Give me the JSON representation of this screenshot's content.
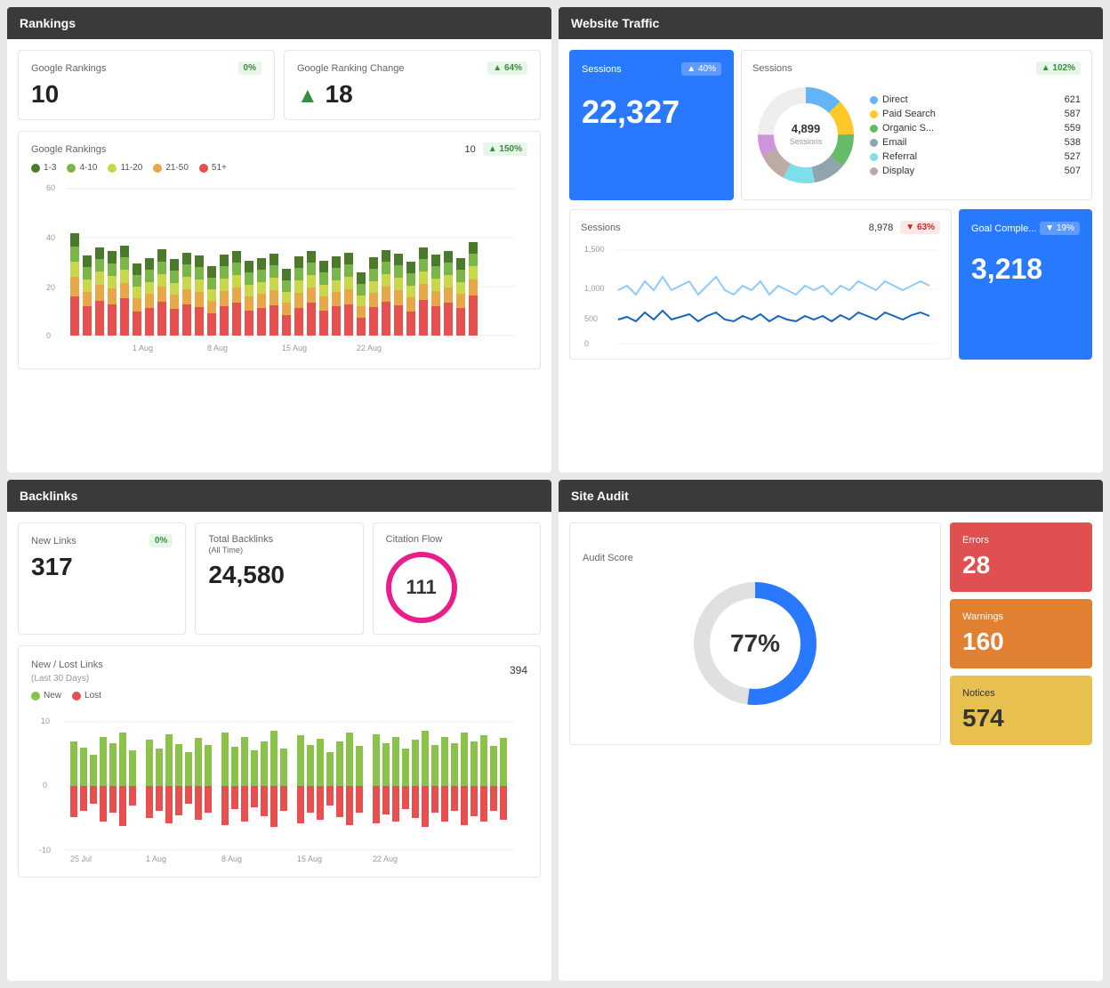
{
  "rankings": {
    "title": "Rankings",
    "google_rankings_label": "Google Rankings",
    "google_rankings_badge": "0%",
    "google_rankings_value": "10",
    "google_ranking_change_label": "Google Ranking Change",
    "google_ranking_change_badge": "▲ 64%",
    "google_ranking_change_value": "18",
    "chart_label": "Google Rankings",
    "chart_value": "10",
    "chart_badge": "▲ 150%",
    "legend": [
      {
        "label": "1-3",
        "color": "#4a7a2a"
      },
      {
        "label": "4-10",
        "color": "#7ab648"
      },
      {
        "label": "11-20",
        "color": "#c8d848"
      },
      {
        "label": "21-50",
        "color": "#e8a848"
      },
      {
        "label": "51+",
        "color": "#e85050"
      }
    ],
    "x_labels": [
      "1 Aug",
      "8 Aug",
      "15 Aug",
      "22 Aug"
    ],
    "y_labels": [
      "60",
      "40",
      "20",
      "0"
    ]
  },
  "traffic": {
    "title": "Website Traffic",
    "sessions_label": "Sessions",
    "sessions_badge": "▲ 40%",
    "sessions_value": "22,327",
    "donut_center": "4,899",
    "donut_sub": "Sessions",
    "donut_label": "Sessions",
    "donut_badge": "▲ 102%",
    "donut_legend": [
      {
        "label": "Direct",
        "value": "621",
        "color": "#64b5f6"
      },
      {
        "label": "Paid Search",
        "value": "587",
        "color": "#ffca28"
      },
      {
        "label": "Organic S...",
        "value": "559",
        "color": "#66bb6a"
      },
      {
        "label": "Email",
        "value": "538",
        "color": "#90a4ae"
      },
      {
        "label": "Referral",
        "value": "527",
        "color": "#80deea"
      },
      {
        "label": "Display",
        "value": "507",
        "color": "#bcaaa4"
      }
    ],
    "sessions2_label": "Sessions",
    "sessions2_value": "8,978",
    "sessions2_badge": "▼ 63%",
    "sessions2_badge_color": "red",
    "goal_label": "Goal Comple...",
    "goal_badge": "▼ 19%",
    "goal_value": "3,218",
    "x_labels": [
      "1 Aug",
      "8 Aug",
      "15 Aug",
      "22 Aug"
    ],
    "y_labels": [
      "1,500",
      "1,000",
      "500",
      "0"
    ]
  },
  "backlinks": {
    "title": "Backlinks",
    "new_links_label": "New Links",
    "new_links_badge": "0%",
    "new_links_value": "317",
    "total_backlinks_label": "Total Backlinks",
    "total_backlinks_sub": "(All Time)",
    "total_backlinks_value": "24,580",
    "citation_flow_label": "Citation Flow",
    "citation_flow_value": "111",
    "chart_label": "New / Lost Links",
    "chart_sub": "(Last 30 Days)",
    "chart_value": "394",
    "legend_new": "New",
    "legend_lost": "Lost",
    "x_labels": [
      "25 Jul",
      "1 Aug",
      "8 Aug",
      "15 Aug",
      "22 Aug"
    ],
    "y_labels": [
      "10",
      "0",
      "-10"
    ]
  },
  "site_audit": {
    "title": "Site Audit",
    "audit_score_label": "Audit Score",
    "audit_score_value": "77%",
    "errors_label": "Errors",
    "errors_value": "28",
    "warnings_label": "Warnings",
    "warnings_value": "160",
    "notices_label": "Notices",
    "notices_value": "574"
  }
}
